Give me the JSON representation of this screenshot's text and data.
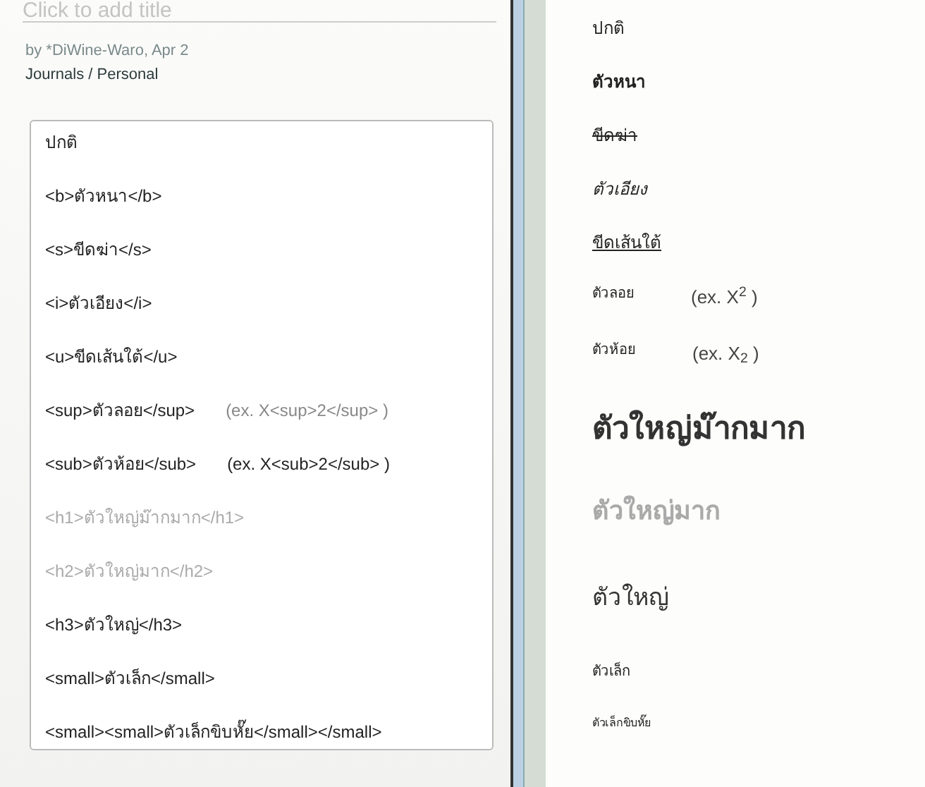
{
  "editor": {
    "title_placeholder": "Click to add title",
    "byline": "by *DiWine-Waro, Apr 2",
    "category": "Journals / Personal",
    "lines": [
      {
        "code": "ปกติ",
        "faded": false
      },
      {
        "code": "<b>ตัวหนา</b>",
        "faded": false
      },
      {
        "code": "<s>ขีดฆ่า</s>",
        "faded": false
      },
      {
        "code": "<i>ตัวเอียง</i>",
        "faded": false
      },
      {
        "code": "<u>ขีดเส้นใต้</u>",
        "faded": false
      },
      {
        "code": "<sup>ตัวลอย</sup>",
        "faded": false,
        "example": "(ex. X<sup>2</sup> )",
        "example_faded": true
      },
      {
        "code": "<sub>ตัวห้อย</sub>",
        "faded": false,
        "example": "(ex. X<sub>2</sub> )",
        "example_faded": false
      },
      {
        "code": "<h1>ตัวใหญ่ม๊ากมาก</h1>",
        "faded": true
      },
      {
        "code": "<h2>ตัวใหญ่มาก</h2>",
        "faded": true
      },
      {
        "code": "<h3>ตัวใหญ่</h3>",
        "faded": false
      },
      {
        "code": "<small>ตัวเล็ก</small>",
        "faded": false
      },
      {
        "code": "<small><small>ตัวเล็กขิบหั๊ย</small></small>",
        "faded": false
      }
    ]
  },
  "preview": {
    "items": [
      {
        "kind": "normal",
        "text": "ปกติ"
      },
      {
        "kind": "bold",
        "text": "ตัวหนา"
      },
      {
        "kind": "strike",
        "text": "ขีดฆ่า"
      },
      {
        "kind": "italic",
        "text": "ตัวเอียง"
      },
      {
        "kind": "underline",
        "text": "ขีดเส้นใต้"
      },
      {
        "kind": "sup",
        "text": "ตัวลอย",
        "example": "(ex. X$^{2}$ )"
      },
      {
        "kind": "sub",
        "text": "ตัวห้อย",
        "example": "(ex. X$_{2}$ )"
      },
      {
        "kind": "h1",
        "text": "ตัวใหญ่ม๊ากมาก"
      },
      {
        "kind": "h2",
        "text": "ตัวใหญ่มาก"
      },
      {
        "kind": "h3",
        "text": "ตัวใหญ่"
      },
      {
        "kind": "small",
        "text": "ตัวเล็ก"
      },
      {
        "kind": "smaller",
        "text": "ตัวเล็กขิบหั๊ย"
      }
    ]
  }
}
